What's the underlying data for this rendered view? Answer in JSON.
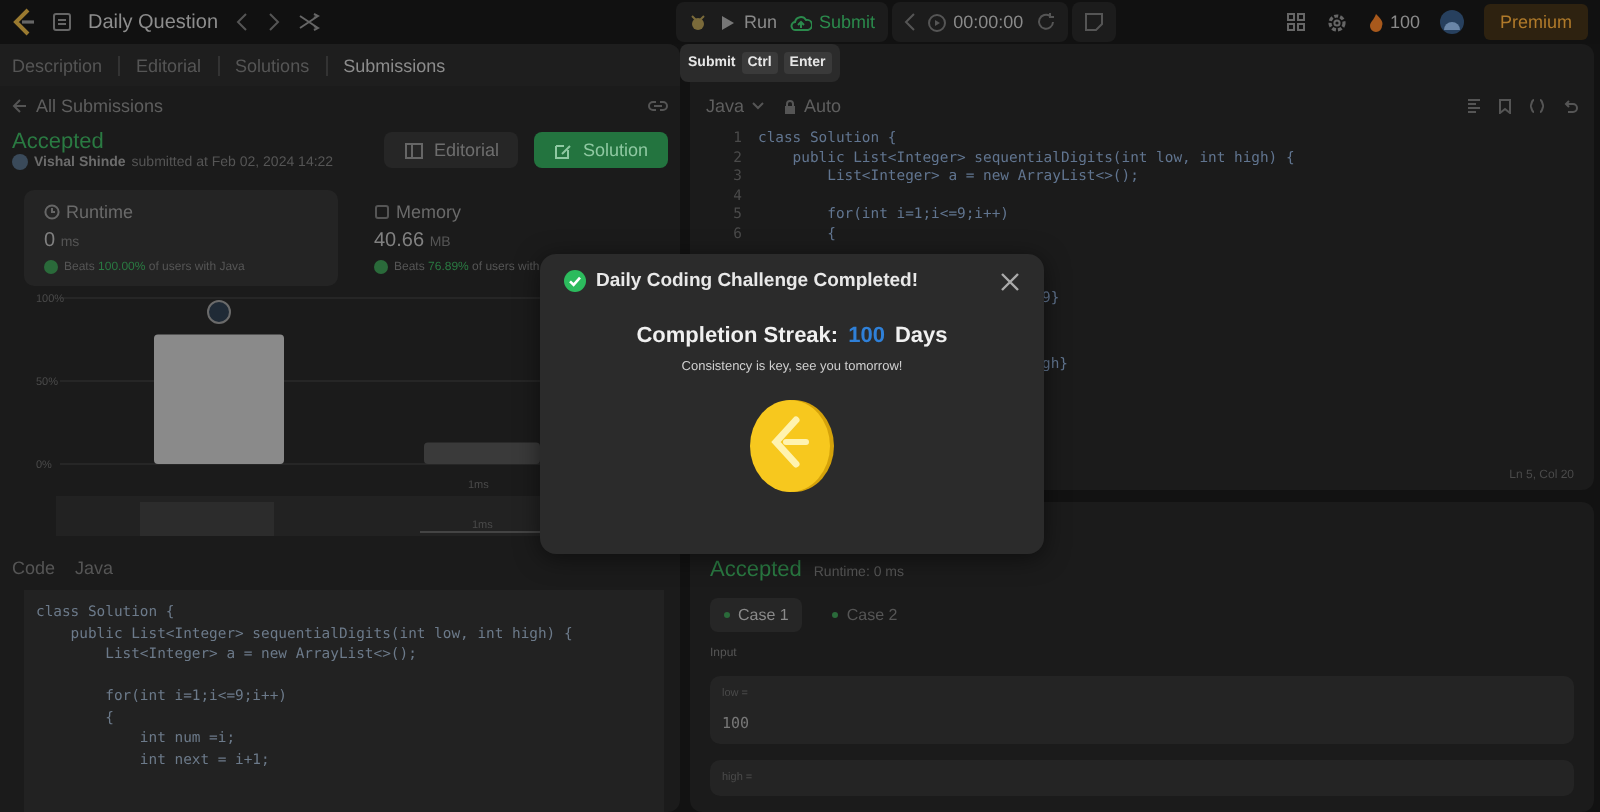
{
  "top_bar": {
    "title": "Daily Question",
    "run_label": "Run",
    "submit_label": "Submit",
    "timer": "00:00:00",
    "streak_count": "100",
    "premium_label": "Premium"
  },
  "tooltip": {
    "label": "Submit",
    "keys": [
      "Ctrl",
      "Enter"
    ]
  },
  "tabs": [
    {
      "label": "Description",
      "selected": false
    },
    {
      "label": "Editorial",
      "selected": false
    },
    {
      "label": "Solutions",
      "selected": false
    },
    {
      "label": "Submissions",
      "selected": true
    }
  ],
  "submission": {
    "back_link": "All Submissions",
    "status": "Accepted",
    "author": "Vishal Shinde",
    "submitted": "submitted at Feb 02, 2024 14:22",
    "buttons": [
      {
        "label": "Editorial",
        "kind": "outline"
      },
      {
        "label": "Solution",
        "kind": "primary"
      }
    ],
    "stats": [
      {
        "label": "Runtime",
        "value": "0",
        "unit": "ms",
        "beats_label": "Beats",
        "percent": "100.00%",
        "suffix": "of users with Java"
      },
      {
        "label": "Memory",
        "value": "40.66",
        "unit": "MB",
        "beats_label": "Beats",
        "percent": "76.89%",
        "suffix": "of users with"
      }
    ],
    "bar_caption": "1ms",
    "chart_data": {
      "type": "bar",
      "series": [
        {
          "values": [
            78,
            13
          ]
        }
      ],
      "ylim": [
        0,
        100
      ],
      "yticks": [
        {
          "value": 0,
          "label": "0%"
        },
        {
          "value": 50,
          "label": "50%"
        },
        {
          "value": 100,
          "label": "100%"
        }
      ]
    },
    "navigator_label": "1ms",
    "code_label": "Code",
    "code_language": "Java",
    "code_lines": [
      {
        "code": "class Solution {"
      },
      {
        "code": "    public List<Integer> sequentialDigits(int low, int high) {"
      },
      {
        "code": "        List<Integer> a = new ArrayList<>();"
      },
      {
        "code": "        for(int i=1;i<=9;i++)",
        "blank_before": true
      },
      {
        "code": "        {"
      },
      {
        "code": "            int num =i;"
      },
      {
        "code": "            int next = i+1;"
      }
    ]
  },
  "editor": {
    "language": "Java",
    "mode": "Auto",
    "cursor": "Ln 5, Col 20",
    "lines": [
      {
        "number": "1",
        "code": "class Solution {"
      },
      {
        "number": "2",
        "code": "    public List<Integer> sequentialDigits(int low, int high) {"
      },
      {
        "number": "3",
        "code": "        List<Integer> a = new ArrayList<>();"
      },
      {
        "number": "4"
      },
      {
        "number": "5",
        "code": "        for(int i=1;i<=9;i++)"
      },
      {
        "number": "6",
        "code": "        {"
      },
      {
        "kind": "fragment",
        "code": "9}",
        "blank_before": true
      },
      {
        "kind": "fragment",
        "code": "gh}",
        "blank_before": true
      }
    ]
  },
  "result": {
    "status": "Accepted",
    "runtime": "Runtime: 0 ms",
    "cases": [
      {
        "label": "Case 1",
        "selected": true
      },
      {
        "label": "Case 2",
        "selected": false
      }
    ],
    "input_label": "Input",
    "inputs": [
      {
        "name": "low =",
        "value": "100"
      },
      {
        "name": "high ="
      }
    ]
  },
  "dialog": {
    "title": "Daily Coding Challenge Completed!",
    "streak_label": "Completion Streak:",
    "streak_value": "100",
    "streak_unit": "Days",
    "message": "Consistency is key, see you tomorrow!"
  }
}
